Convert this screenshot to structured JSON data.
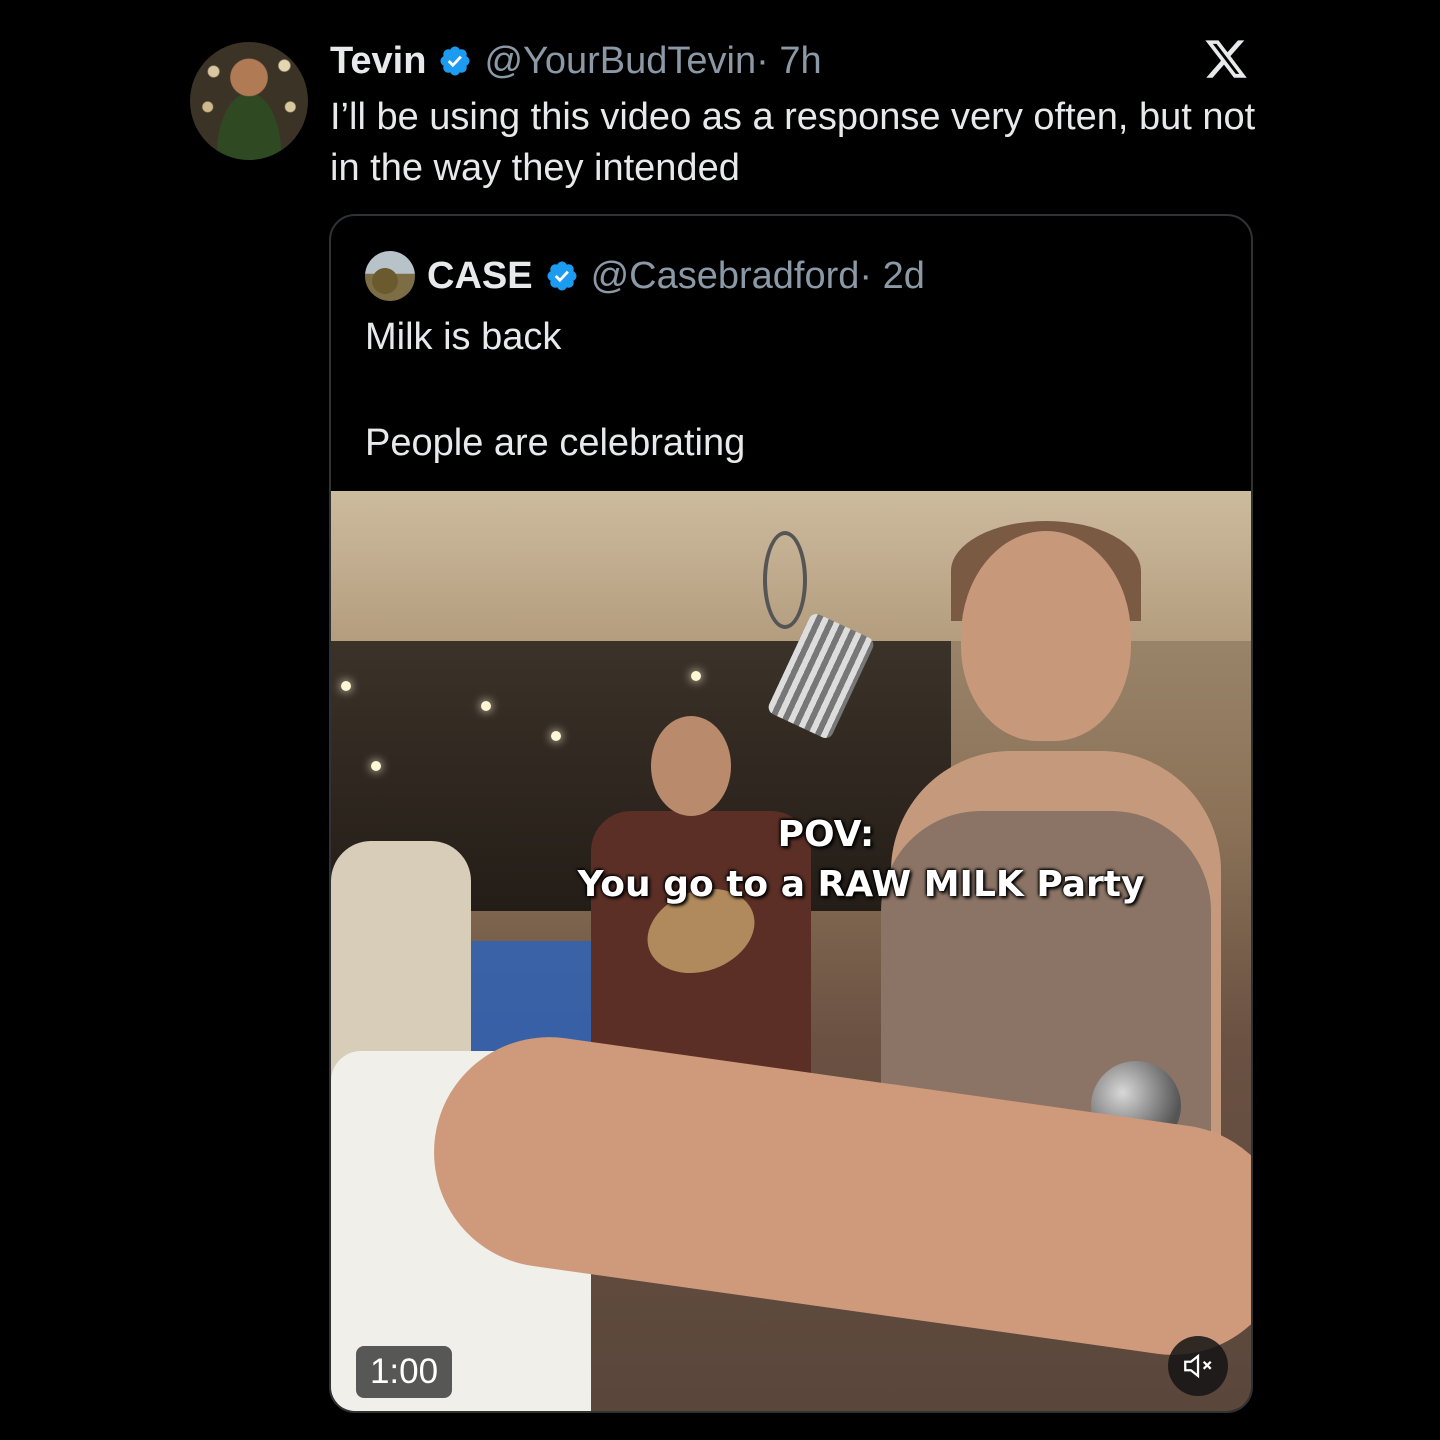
{
  "tweet": {
    "author_name": "Tevin",
    "handle": "@YourBudTevin",
    "time": " · 7h",
    "text": "I’ll be using this video as a response very often, but not in the way they intended"
  },
  "quoted": {
    "author_name": "CASE",
    "handle": "@Casebradford",
    "time": " · 2d",
    "text_line1": "Milk is back",
    "text_line2": "People are celebrating",
    "video": {
      "caption_pov": "POV:",
      "caption_line": "You go to a RAW MILK Party",
      "duration": "1:00"
    }
  },
  "icons": {
    "verified": "verified-badge-icon",
    "logo": "x-logo-icon",
    "mute": "speaker-muted-icon"
  },
  "colors": {
    "background": "#000000",
    "text": "#e7e9ea",
    "secondary_text": "#8b98a5",
    "verified_blue": "#1d9bf0",
    "border": "#2f3336"
  }
}
